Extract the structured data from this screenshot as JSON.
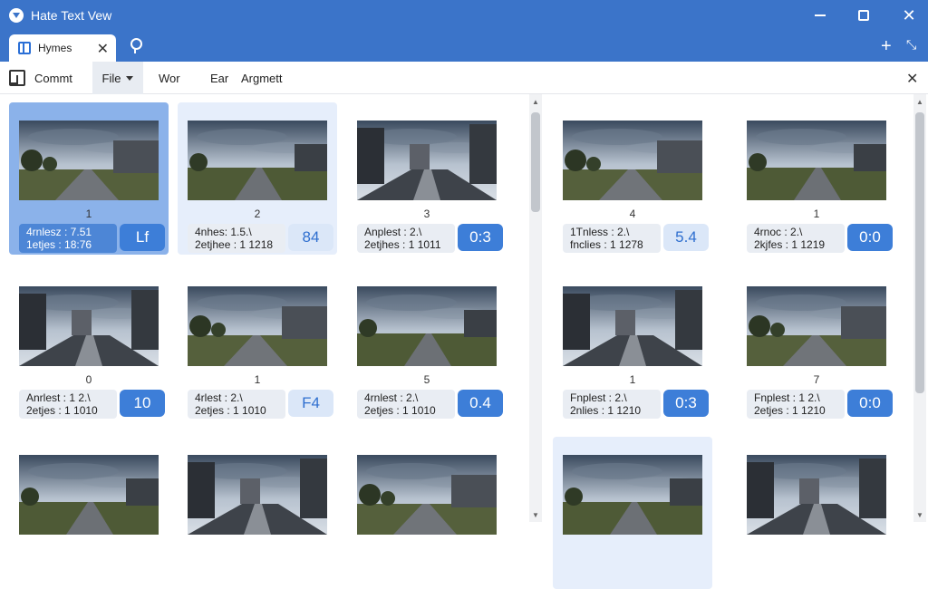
{
  "window": {
    "title": "Hate Text Vew",
    "controls": {
      "minimize_icon": "minimize-icon",
      "maximize_icon": "maximize-icon",
      "close_glyph": "✕"
    }
  },
  "tabs": [
    {
      "label": "Hymes",
      "close_glyph": "✕",
      "icon": "document-icon"
    }
  ],
  "tabstrip_actions": {
    "plus_glyph": "+",
    "pin_glyph": "⤡"
  },
  "menu": {
    "items": [
      {
        "label": "Commt"
      },
      {
        "label": "File"
      },
      {
        "label": "Wor"
      },
      {
        "label": "Ear"
      },
      {
        "label": "Argmett"
      }
    ],
    "close_glyph": "✕"
  },
  "colors": {
    "accent": "#3b74c9",
    "badge": "#3d7ed8",
    "selected": "#8bb2ea"
  },
  "thumbnails": [
    {
      "number": "1",
      "line1": "4rnlesz : 7.51",
      "line2": "1etjes : 18:76",
      "badge": "Lf",
      "state": "selected"
    },
    {
      "number": "2",
      "line1": "4nhes: 1.5.\\",
      "line2": "2etjhee : 1 1218",
      "badge": "84",
      "state": "hover"
    },
    {
      "number": "3",
      "line1": "Anplest : 2.\\",
      "line2": "2etjhes : 1 1011",
      "badge": "0:3",
      "state": "normal"
    },
    {
      "number": "4",
      "line1": "1Tnless : 2.\\",
      "line2": "fnclies : 1 1278",
      "badge": "5.4",
      "state": "normal"
    },
    {
      "number": "1",
      "line1": "4rnoc : 2.\\",
      "line2": "2kjfes : 1 1219",
      "badge": "0:0",
      "state": "normal"
    },
    {
      "number": "0",
      "line1": "Anrlest : 1 2.\\",
      "line2": "2etjes : 1 1010",
      "badge": "10",
      "state": "normal"
    },
    {
      "number": "1",
      "line1": "4rlest : 2.\\",
      "line2": "2etjes : 1 1010",
      "badge": "F4",
      "state": "normal"
    },
    {
      "number": "5",
      "line1": "4rnlest : 2.\\",
      "line2": "2etjes : 1 1010",
      "badge": "0.4",
      "state": "normal"
    },
    {
      "number": "1",
      "line1": "Fnplest : 2.\\",
      "line2": "2nlies : 1 1210",
      "badge": "0:3",
      "state": "normal"
    },
    {
      "number": "7",
      "line1": "Fnplest : 1 2.\\",
      "line2": "2etjes : 1 1210",
      "badge": "0:0",
      "state": "normal"
    },
    {
      "number": "",
      "line1": "",
      "line2": "",
      "badge": "",
      "state": "normal"
    },
    {
      "number": "",
      "line1": "",
      "line2": "",
      "badge": "",
      "state": "normal"
    },
    {
      "number": "",
      "line1": "",
      "line2": "",
      "badge": "",
      "state": "normal"
    },
    {
      "number": "",
      "line1": "",
      "line2": "",
      "badge": "",
      "state": "hover"
    },
    {
      "number": "",
      "line1": "",
      "line2": "",
      "badge": "",
      "state": "normal"
    }
  ]
}
